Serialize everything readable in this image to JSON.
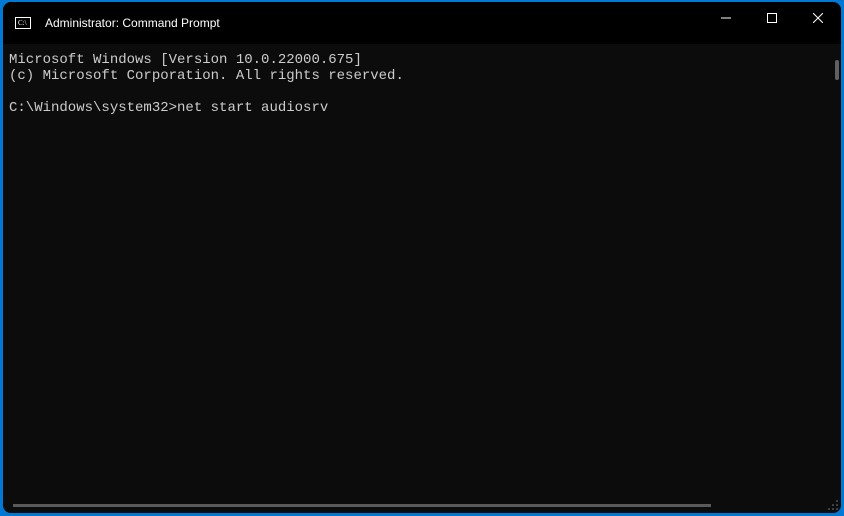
{
  "titlebar": {
    "title": "Administrator: Command Prompt"
  },
  "terminal": {
    "line1": "Microsoft Windows [Version 10.0.22000.675]",
    "line2": "(c) Microsoft Corporation. All rights reserved.",
    "prompt": "C:\\Windows\\system32>",
    "command": "net start audiosrv"
  }
}
